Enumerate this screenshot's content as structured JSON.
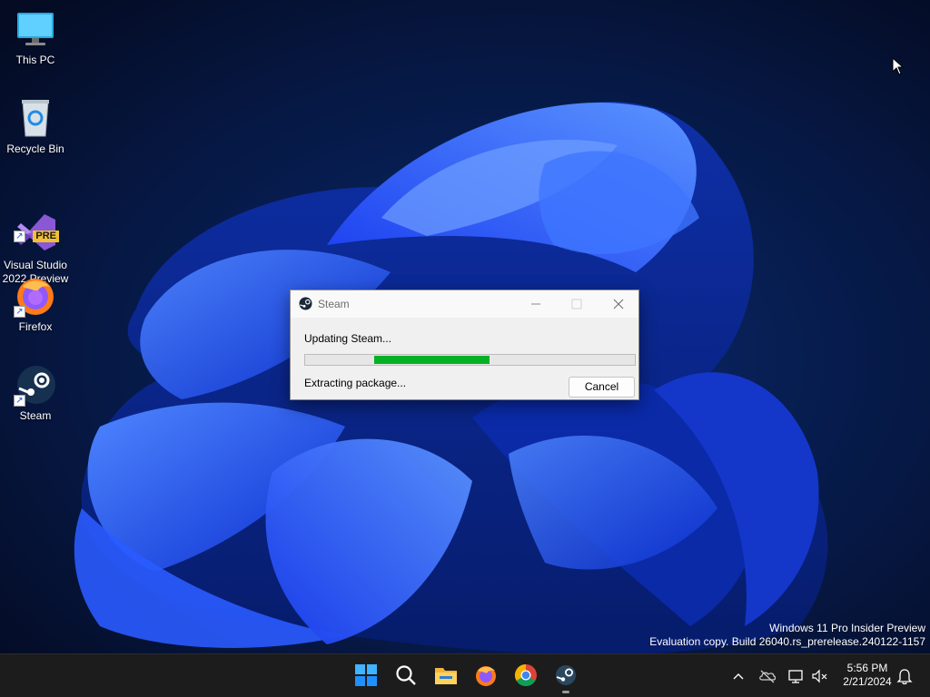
{
  "desktop": {
    "icons": [
      {
        "label": "This PC",
        "icon": "computer-icon"
      },
      {
        "label": "Recycle Bin",
        "icon": "recycle-bin-icon"
      },
      {
        "label": "Visual Studio\n2022 Preview",
        "icon": "visual-studio-icon",
        "badge": "PRE"
      },
      {
        "label": "Firefox",
        "icon": "firefox-icon"
      },
      {
        "label": "Steam",
        "icon": "steam-icon"
      }
    ]
  },
  "dialog": {
    "title": "Steam",
    "status": "Updating Steam...",
    "progress_start_fraction": 0.21,
    "progress_end_fraction": 0.56,
    "substatus": "Extracting package...",
    "cancel_label": "Cancel",
    "progress_color": "#06b025"
  },
  "watermark": {
    "line1": "Windows 11 Pro Insider Preview",
    "line2": "Evaluation copy. Build 26040.rs_prerelease.240122-1157"
  },
  "taskbar": {
    "apps": [
      "start-icon",
      "search-icon",
      "file-explorer-icon",
      "firefox-icon",
      "chrome-icon",
      "steam-icon"
    ],
    "active_app": "steam-icon",
    "tray": [
      "chevron-up-icon",
      "onedrive-icon",
      "network-icon",
      "volume-muted-icon"
    ],
    "time": "5:56 PM",
    "date": "2/21/2024",
    "notification_icon": "bell-icon"
  }
}
